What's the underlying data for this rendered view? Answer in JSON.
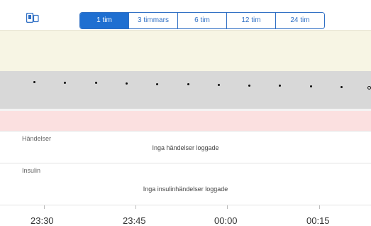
{
  "toolbar": {
    "device_icon": "device-icon",
    "ranges": [
      "1 tim",
      "3 timmars",
      "6 tim",
      "12 tim",
      "24 tim"
    ],
    "selected_range": "1 tim",
    "accent_color": "#1f6fd1"
  },
  "chart": {
    "band_colors": {
      "high": "#f7f5e4",
      "target": "#d8d8d8",
      "low": "#fbe0e0"
    },
    "point_count": 12
  },
  "events": {
    "title": "Händelser",
    "empty_message": "Inga händelser loggade"
  },
  "insulin": {
    "title": "Insulin",
    "empty_message": "Inga insulinhändelser loggade"
  },
  "time_axis": {
    "labels": [
      "23:30",
      "23:45",
      "00:00",
      "00:15"
    ]
  }
}
